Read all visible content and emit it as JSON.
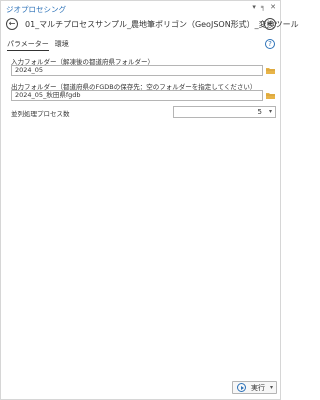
{
  "pane": {
    "title": "ジオプロセシング",
    "header_icons": [
      "pin-icon",
      "auto-hide-icon",
      "close-icon"
    ],
    "header_glyphs": [
      "▾",
      "╕",
      "✕"
    ]
  },
  "tool": {
    "back_glyph": "←",
    "title": "01_マルチプロセスサンプル_農地筆ポリゴン（GeoJSON形式）_変換ツール",
    "add_glyph": "+"
  },
  "tabs": [
    {
      "label": "パラメーター",
      "active": true
    },
    {
      "label": "環境",
      "active": false
    }
  ],
  "help_glyph": "?",
  "fields": {
    "input_folder": {
      "label": "入力フォルダー（解凍後の都道府県フォルダー）",
      "value": "2024_05"
    },
    "output_folder": {
      "label": "出力フォルダー（都道府県のFGDBの保存先：空のフォルダーを指定してください）",
      "value": "2024_05_秋田県fgdb"
    },
    "parallel": {
      "label": "並列処理プロセス数",
      "value": "5",
      "caret": "▾"
    }
  },
  "run": {
    "label": "実行",
    "caret": "▾"
  },
  "colors": {
    "accent": "#2d72b8",
    "folder": "#e8b448",
    "border": "#b5b5b5"
  }
}
